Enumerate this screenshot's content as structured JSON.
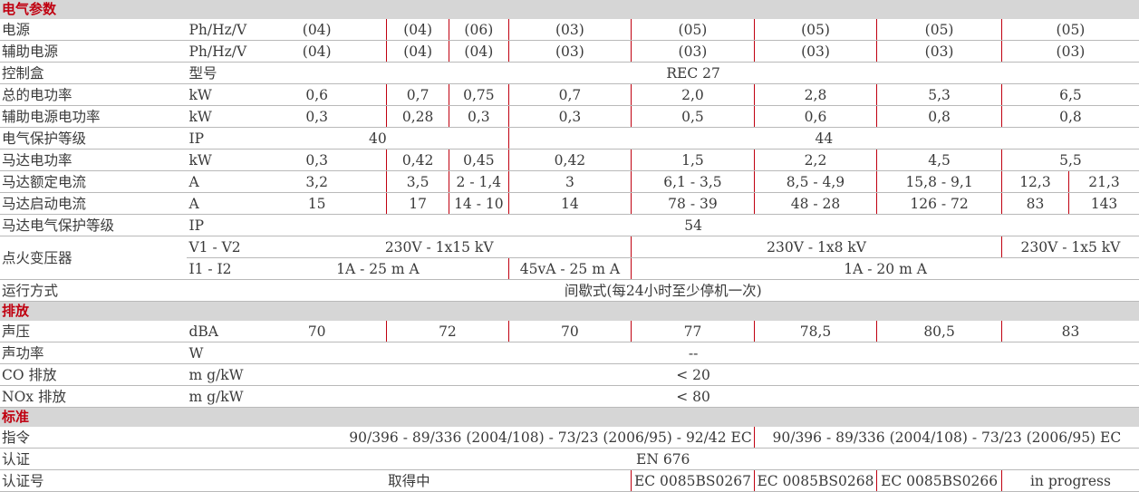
{
  "sections": {
    "electrical": "电气参数",
    "emission": "排放",
    "standards": "标准"
  },
  "rows": {
    "power_supply": {
      "label": "电源",
      "unit": "Ph/Hz/V",
      "v": [
        "(04)",
        "(04)",
        "(06)",
        "(03)",
        "(05)",
        "(05)",
        "(05)",
        "(05)"
      ]
    },
    "aux_power": {
      "label": "辅助电源",
      "unit": "Ph/Hz/V",
      "v": [
        "(04)",
        "(04)",
        "(04)",
        "(03)",
        "(03)",
        "(03)",
        "(03)",
        "(03)"
      ]
    },
    "control_box": {
      "label": "控制盒",
      "unit": "型号",
      "v": "REC 27"
    },
    "total_power": {
      "label": "总的电功率",
      "unit": "kW",
      "v": [
        "0,6",
        "0,7",
        "0,75",
        "0,7",
        "2,0",
        "2,8",
        "5,3",
        "6,5"
      ]
    },
    "aux_power_rating": {
      "label": "辅助电源电功率",
      "unit": "kW",
      "v": [
        "0,3",
        "0,28",
        "0,3",
        "0,3",
        "0,5",
        "0,6",
        "0,8",
        "0,8"
      ]
    },
    "protection": {
      "label": "电气保护等级",
      "unit": "IP",
      "v": [
        "40",
        "44"
      ]
    },
    "motor_power": {
      "label": "马达电功率",
      "unit": "kW",
      "v": [
        "0,3",
        "0,42",
        "0,45",
        "0,42",
        "1,5",
        "2,2",
        "4,5",
        "5,5"
      ]
    },
    "motor_rated_current": {
      "label": "马达额定电流",
      "unit": "A",
      "v": [
        "3,2",
        "3,5",
        "2 - 1,4",
        "3",
        "6,1 - 3,5",
        "8,5 - 4,9",
        "15,8 - 9,1",
        "12,3",
        "21,3"
      ]
    },
    "motor_start_current": {
      "label": "马达启动电流",
      "unit": "A",
      "v": [
        "15",
        "17",
        "14 - 10",
        "14",
        "78 - 39",
        "48 - 28",
        "126 - 72",
        "83",
        "143"
      ]
    },
    "motor_protection": {
      "label": "马达电气保护等级",
      "unit": "IP",
      "v": "54"
    },
    "ignition": {
      "label": "点火变压器",
      "unit1": "V1 - V2",
      "v1": [
        "230V - 1x15 kV",
        "230V - 1x8 kV",
        "230V - 1x5 kV"
      ],
      "unit2": "I1 - I2",
      "v2": [
        "1A - 25 m A",
        "45vA - 25 m A",
        "1A - 20 m A"
      ]
    },
    "operation": {
      "label": "运行方式",
      "v": "间歇式(每24小时至少停机一次)"
    },
    "sound_pressure": {
      "label": "声压",
      "unit": "dBA",
      "v": [
        "70",
        "72",
        "70",
        "77",
        "78,5",
        "80,5",
        "83"
      ]
    },
    "sound_power": {
      "label": "声功率",
      "unit": "W",
      "v": "--"
    },
    "co": {
      "label": "CO 排放",
      "unit": "m g/kW h",
      "v": "< 20"
    },
    "nox": {
      "label": "NOx 排放",
      "unit": "m g/kW h",
      "v": "< 80"
    },
    "directive": {
      "label": "指令",
      "v": [
        "90/396 - 89/336 (2004/108) - 73/23 (2006/95) - 92/42 EC",
        "90/396 - 89/336 (2004/108) - 73/23 (2006/95) EC"
      ]
    },
    "certification": {
      "label": "认证",
      "v": "EN 676"
    },
    "cert_no": {
      "label": "认证号",
      "v": [
        "取得中",
        "EC 0085BS0267",
        "EC 0085BS0268",
        "EC 0085BS0266",
        "in progress"
      ]
    }
  }
}
